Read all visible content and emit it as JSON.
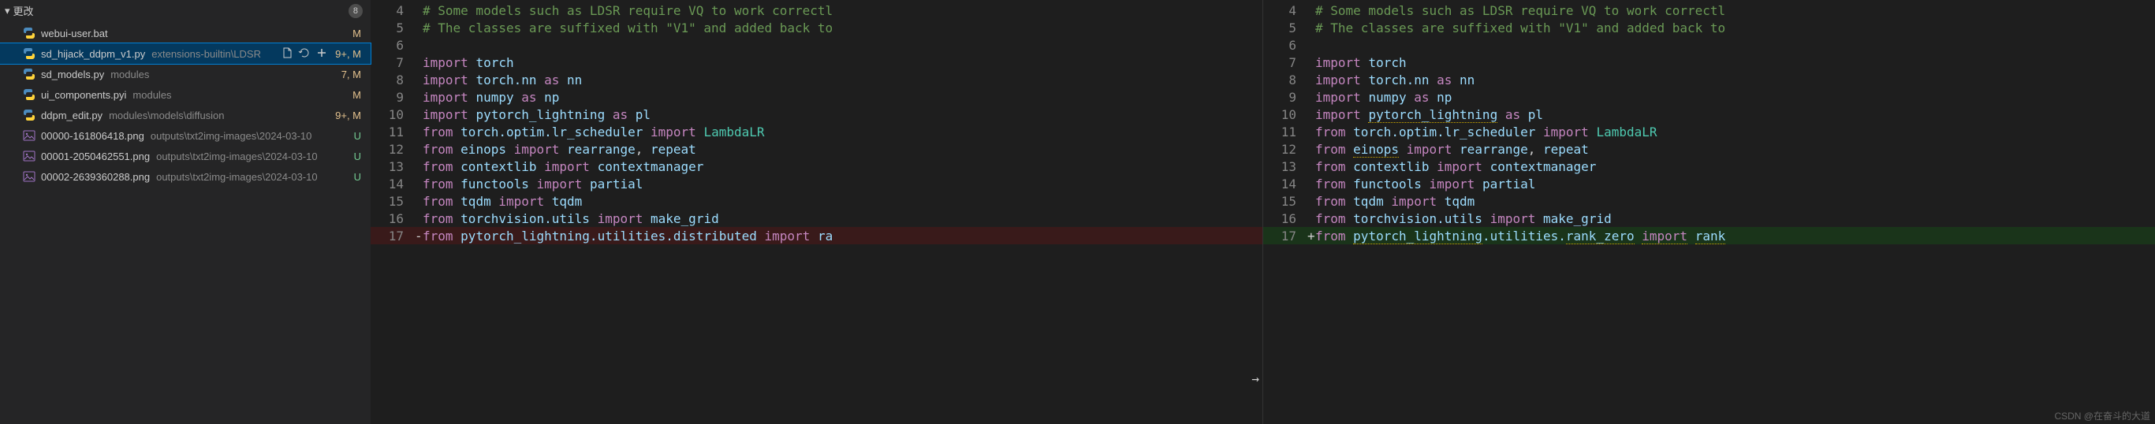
{
  "sidebar": {
    "header_label": "更改",
    "badge": "8",
    "files": [
      {
        "icon": "py",
        "name": "webui-user.bat",
        "descr": "",
        "status": "M"
      },
      {
        "icon": "py",
        "name": "sd_hijack_ddpm_v1.py",
        "descr": "extensions-builtin\\LDSR",
        "status": "9+, M",
        "selected": true
      },
      {
        "icon": "py",
        "name": "sd_models.py",
        "descr": "modules",
        "status": "7, M"
      },
      {
        "icon": "py",
        "name": "ui_components.pyi",
        "descr": "modules",
        "status": "M"
      },
      {
        "icon": "py",
        "name": "ddpm_edit.py",
        "descr": "modules\\models\\diffusion",
        "status": "9+, M"
      },
      {
        "icon": "img",
        "name": "00000-161806418.png",
        "descr": "outputs\\txt2img-images\\2024-03-10",
        "status": "U"
      },
      {
        "icon": "img",
        "name": "00001-2050462551.png",
        "descr": "outputs\\txt2img-images\\2024-03-10",
        "status": "U"
      },
      {
        "icon": "img",
        "name": "00002-2639360288.png",
        "descr": "outputs\\txt2img-images\\2024-03-10",
        "status": "U"
      }
    ],
    "row_actions": [
      "open-file",
      "discard",
      "stage"
    ]
  },
  "code_left": [
    {
      "n": 4,
      "tokens": [
        [
          "cmt",
          "# Some models such as LDSR require VQ to work correctl"
        ]
      ]
    },
    {
      "n": 5,
      "tokens": [
        [
          "cmt",
          "# The classes are suffixed with \"V1\" and added back to"
        ]
      ]
    },
    {
      "n": 6,
      "tokens": []
    },
    {
      "n": 7,
      "tokens": [
        [
          "kw",
          "import"
        ],
        [
          "",
          " "
        ],
        [
          "id",
          "torch"
        ]
      ]
    },
    {
      "n": 8,
      "tokens": [
        [
          "kw",
          "import"
        ],
        [
          "",
          " "
        ],
        [
          "id",
          "torch.nn"
        ],
        [
          "",
          " "
        ],
        [
          "as",
          "as"
        ],
        [
          "",
          " "
        ],
        [
          "id",
          "nn"
        ]
      ]
    },
    {
      "n": 9,
      "tokens": [
        [
          "kw",
          "import"
        ],
        [
          "",
          " "
        ],
        [
          "id",
          "numpy"
        ],
        [
          "",
          " "
        ],
        [
          "as",
          "as"
        ],
        [
          "",
          " "
        ],
        [
          "id",
          "np"
        ]
      ]
    },
    {
      "n": 10,
      "tokens": [
        [
          "kw",
          "import"
        ],
        [
          "",
          " "
        ],
        [
          "id",
          "pytorch_lightning"
        ],
        [
          "",
          " "
        ],
        [
          "as",
          "as"
        ],
        [
          "",
          " "
        ],
        [
          "id",
          "pl"
        ]
      ]
    },
    {
      "n": 11,
      "tokens": [
        [
          "kw",
          "from"
        ],
        [
          "",
          " "
        ],
        [
          "id",
          "torch.optim.lr_scheduler"
        ],
        [
          "",
          " "
        ],
        [
          "kw",
          "import"
        ],
        [
          "",
          " "
        ],
        [
          "mod",
          "LambdaLR"
        ]
      ]
    },
    {
      "n": 12,
      "tokens": [
        [
          "kw",
          "from"
        ],
        [
          "",
          " "
        ],
        [
          "id",
          "einops"
        ],
        [
          "",
          " "
        ],
        [
          "kw",
          "import"
        ],
        [
          "",
          " "
        ],
        [
          "id",
          "rearrange"
        ],
        [
          "",
          ", "
        ],
        [
          "id",
          "repeat"
        ]
      ]
    },
    {
      "n": 13,
      "tokens": [
        [
          "kw",
          "from"
        ],
        [
          "",
          " "
        ],
        [
          "id",
          "contextlib"
        ],
        [
          "",
          " "
        ],
        [
          "kw",
          "import"
        ],
        [
          "",
          " "
        ],
        [
          "id",
          "contextmanager"
        ]
      ]
    },
    {
      "n": 14,
      "tokens": [
        [
          "kw",
          "from"
        ],
        [
          "",
          " "
        ],
        [
          "id",
          "functools"
        ],
        [
          "",
          " "
        ],
        [
          "kw",
          "import"
        ],
        [
          "",
          " "
        ],
        [
          "id",
          "partial"
        ]
      ]
    },
    {
      "n": 15,
      "tokens": [
        [
          "kw",
          "from"
        ],
        [
          "",
          " "
        ],
        [
          "id",
          "tqdm"
        ],
        [
          "",
          " "
        ],
        [
          "kw",
          "import"
        ],
        [
          "",
          " "
        ],
        [
          "id",
          "tqdm"
        ]
      ]
    },
    {
      "n": 16,
      "tokens": [
        [
          "kw",
          "from"
        ],
        [
          "",
          " "
        ],
        [
          "id",
          "torchvision.utils"
        ],
        [
          "",
          " "
        ],
        [
          "kw",
          "import"
        ],
        [
          "",
          " "
        ],
        [
          "id",
          "make_grid"
        ]
      ]
    },
    {
      "n": 17,
      "diff": "removed",
      "tokens": [
        [
          "kw",
          "from"
        ],
        [
          "",
          " "
        ],
        [
          "id",
          "pytorch_lightning.utilities.distributed"
        ],
        [
          "",
          " "
        ],
        [
          "kw",
          "import"
        ],
        [
          "",
          " "
        ],
        [
          "id",
          "ra"
        ]
      ]
    }
  ],
  "code_right": [
    {
      "n": 4,
      "tokens": [
        [
          "cmt",
          "# Some models such as LDSR require VQ to work correctl"
        ]
      ]
    },
    {
      "n": 5,
      "tokens": [
        [
          "cmt",
          "# The classes are suffixed with \"V1\" and added back to"
        ]
      ]
    },
    {
      "n": 6,
      "tokens": []
    },
    {
      "n": 7,
      "tokens": [
        [
          "kw",
          "import"
        ],
        [
          "",
          " "
        ],
        [
          "id",
          "torch"
        ]
      ]
    },
    {
      "n": 8,
      "tokens": [
        [
          "kw",
          "import"
        ],
        [
          "",
          " "
        ],
        [
          "id",
          "torch.nn"
        ],
        [
          "",
          " "
        ],
        [
          "as",
          "as"
        ],
        [
          "",
          " "
        ],
        [
          "id",
          "nn"
        ]
      ]
    },
    {
      "n": 9,
      "tokens": [
        [
          "kw",
          "import"
        ],
        [
          "",
          " "
        ],
        [
          "id",
          "numpy"
        ],
        [
          "",
          " "
        ],
        [
          "as",
          "as"
        ],
        [
          "",
          " "
        ],
        [
          "id",
          "np"
        ]
      ]
    },
    {
      "n": 10,
      "warn": [
        "pytorch_lightning"
      ],
      "tokens": [
        [
          "kw",
          "import"
        ],
        [
          "",
          " "
        ],
        [
          "id warn",
          "pytorch_lightning"
        ],
        [
          "",
          " "
        ],
        [
          "as",
          "as"
        ],
        [
          "",
          " "
        ],
        [
          "id",
          "pl"
        ]
      ]
    },
    {
      "n": 11,
      "tokens": [
        [
          "kw",
          "from"
        ],
        [
          "",
          " "
        ],
        [
          "id",
          "torch.optim.lr_scheduler"
        ],
        [
          "",
          " "
        ],
        [
          "kw",
          "import"
        ],
        [
          "",
          " "
        ],
        [
          "mod",
          "LambdaLR"
        ]
      ]
    },
    {
      "n": 12,
      "warn": [
        "einops"
      ],
      "tokens": [
        [
          "kw",
          "from"
        ],
        [
          "",
          " "
        ],
        [
          "id warn",
          "einops"
        ],
        [
          "",
          " "
        ],
        [
          "kw",
          "import"
        ],
        [
          "",
          " "
        ],
        [
          "id",
          "rearrange"
        ],
        [
          "",
          ", "
        ],
        [
          "id",
          "repeat"
        ]
      ]
    },
    {
      "n": 13,
      "tokens": [
        [
          "kw",
          "from"
        ],
        [
          "",
          " "
        ],
        [
          "id",
          "contextlib"
        ],
        [
          "",
          " "
        ],
        [
          "kw",
          "import"
        ],
        [
          "",
          " "
        ],
        [
          "id",
          "contextmanager"
        ]
      ]
    },
    {
      "n": 14,
      "tokens": [
        [
          "kw",
          "from"
        ],
        [
          "",
          " "
        ],
        [
          "id",
          "functools"
        ],
        [
          "",
          " "
        ],
        [
          "kw",
          "import"
        ],
        [
          "",
          " "
        ],
        [
          "id",
          "partial"
        ]
      ]
    },
    {
      "n": 15,
      "tokens": [
        [
          "kw",
          "from"
        ],
        [
          "",
          " "
        ],
        [
          "id",
          "tqdm"
        ],
        [
          "",
          " "
        ],
        [
          "kw",
          "import"
        ],
        [
          "",
          " "
        ],
        [
          "id",
          "tqdm"
        ]
      ]
    },
    {
      "n": 16,
      "tokens": [
        [
          "kw",
          "from"
        ],
        [
          "",
          " "
        ],
        [
          "id",
          "torchvision.utils"
        ],
        [
          "",
          " "
        ],
        [
          "kw",
          "import"
        ],
        [
          "",
          " "
        ],
        [
          "id",
          "make_grid"
        ]
      ]
    },
    {
      "n": 17,
      "diff": "added",
      "warn": [
        "pytorch_lightning"
      ],
      "tokens": [
        [
          "kw",
          "from"
        ],
        [
          "",
          " "
        ],
        [
          "id warn",
          "pytorch_lightning"
        ],
        [
          "id",
          ".utilities."
        ],
        [
          "id warn",
          "rank_zero"
        ],
        [
          "",
          " "
        ],
        [
          "kw warn",
          "import"
        ],
        [
          "",
          " "
        ],
        [
          "id warn",
          "rank"
        ]
      ]
    }
  ],
  "watermark": "CSDN @在奋斗的大道"
}
